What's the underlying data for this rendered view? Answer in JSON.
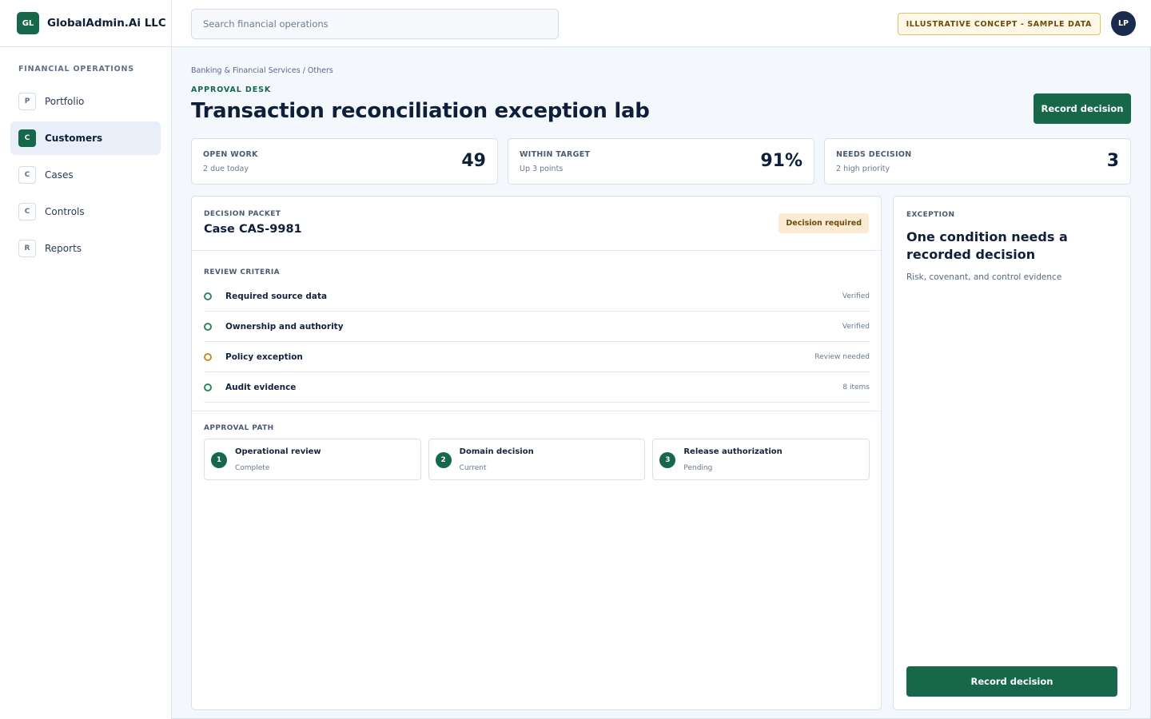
{
  "brand": {
    "logo": "GL",
    "name": "GlobalAdmin.Ai LLC"
  },
  "sidebar": {
    "section_title": "FINANCIAL OPERATIONS",
    "items": [
      {
        "badge": "P",
        "label": "Portfolio"
      },
      {
        "badge": "C",
        "label": "Customers",
        "active": true
      },
      {
        "badge": "C",
        "label": "Cases"
      },
      {
        "badge": "C",
        "label": "Controls"
      },
      {
        "badge": "R",
        "label": "Reports"
      }
    ]
  },
  "topbar": {
    "search_placeholder": "Search financial operations",
    "concept_label": "ILLUSTRATIVE CONCEPT - SAMPLE DATA",
    "avatar_initials": "LP"
  },
  "header": {
    "breadcrumb": "Banking & Financial Services / Others",
    "eyebrow": "APPROVAL DESK",
    "title": "Transaction reconciliation exception lab",
    "action_label": "Record decision"
  },
  "metrics": [
    {
      "label": "OPEN WORK",
      "sub": "2 due today",
      "value": "49"
    },
    {
      "label": "WITHIN TARGET",
      "sub": "Up 3 points",
      "value": "91%"
    },
    {
      "label": "NEEDS DECISION",
      "sub": "2 high priority",
      "value": "3"
    }
  ],
  "packet": {
    "label": "DECISION PACKET",
    "case_id": "Case CAS-9981",
    "badge": "Decision required",
    "criteria_title": "REVIEW CRITERIA",
    "criteria": [
      {
        "label": "Required source data",
        "status": "Verified",
        "state": "ok"
      },
      {
        "label": "Ownership and authority",
        "status": "Verified",
        "state": "ok"
      },
      {
        "label": "Policy exception",
        "status": "Review needed",
        "state": "warn"
      },
      {
        "label": "Audit evidence",
        "status": "8 items",
        "state": "ok"
      }
    ],
    "approval_title": "APPROVAL PATH",
    "steps": [
      {
        "num": "1",
        "title": "Operational review",
        "status": "Complete"
      },
      {
        "num": "2",
        "title": "Domain decision",
        "status": "Current"
      },
      {
        "num": "3",
        "title": "Release authorization",
        "status": "Pending"
      }
    ]
  },
  "exception": {
    "label": "EXCEPTION",
    "title": "One condition needs a recorded decision",
    "subtitle": "Risk, covenant, and control evidence",
    "action_label": "Record decision"
  },
  "colors": {
    "accent": "#17684a",
    "warning": "#d08a24",
    "navy": "#0f1f3a"
  }
}
